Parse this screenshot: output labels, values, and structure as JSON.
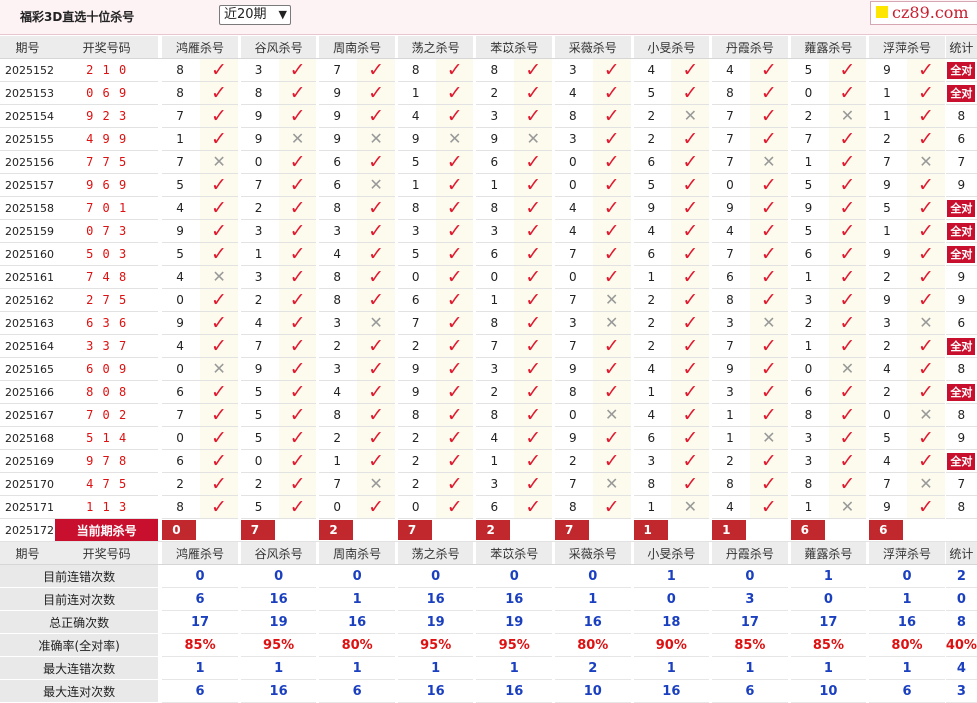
{
  "header": {
    "title": "福彩3D直选十位杀号",
    "period_selected": "近20期",
    "logo_text": "cz89.com"
  },
  "columns": {
    "period": "期号",
    "draw": "开奖号码",
    "stats": "统计",
    "all_correct": "全对",
    "current_label": "当前期杀号"
  },
  "experts": [
    "鸿雁杀号",
    "谷风杀号",
    "周南杀号",
    "荡之杀号",
    "苯苡杀号",
    "采薇杀号",
    "小旻杀号",
    "丹霞杀号",
    "蕹露杀号",
    "浮萍杀号"
  ],
  "rows": [
    {
      "period": "2025152",
      "draw": "2 1 0",
      "kills": [
        "8",
        "3",
        "7",
        "8",
        "8",
        "3",
        "4",
        "4",
        "5",
        "9"
      ],
      "marks": [
        "ok",
        "ok",
        "ok",
        "ok",
        "ok",
        "ok",
        "ok",
        "ok",
        "ok",
        "ok"
      ],
      "stat": "全对"
    },
    {
      "period": "2025153",
      "draw": "0 6 9",
      "kills": [
        "8",
        "8",
        "9",
        "1",
        "2",
        "4",
        "5",
        "8",
        "0",
        "1"
      ],
      "marks": [
        "ok",
        "ok",
        "ok",
        "ok",
        "ok",
        "ok",
        "ok",
        "ok",
        "ok",
        "ok"
      ],
      "stat": "全对"
    },
    {
      "period": "2025154",
      "draw": "9 2 3",
      "kills": [
        "7",
        "9",
        "9",
        "4",
        "3",
        "8",
        "2",
        "7",
        "2",
        "1"
      ],
      "marks": [
        "ok",
        "ok",
        "ok",
        "ok",
        "ok",
        "ok",
        "no",
        "ok",
        "no",
        "ok"
      ],
      "stat": "8"
    },
    {
      "period": "2025155",
      "draw": "4 9 9",
      "kills": [
        "1",
        "9",
        "9",
        "9",
        "9",
        "3",
        "2",
        "7",
        "7",
        "2"
      ],
      "marks": [
        "ok",
        "no",
        "no",
        "no",
        "no",
        "ok",
        "ok",
        "ok",
        "ok",
        "ok"
      ],
      "stat": "6"
    },
    {
      "period": "2025156",
      "draw": "7 7 5",
      "kills": [
        "7",
        "0",
        "6",
        "5",
        "6",
        "0",
        "6",
        "7",
        "1",
        "7"
      ],
      "marks": [
        "no",
        "ok",
        "ok",
        "ok",
        "ok",
        "ok",
        "ok",
        "no",
        "ok",
        "no"
      ],
      "stat": "7"
    },
    {
      "period": "2025157",
      "draw": "9 6 9",
      "kills": [
        "5",
        "7",
        "6",
        "1",
        "1",
        "0",
        "5",
        "0",
        "5",
        "9"
      ],
      "marks": [
        "ok",
        "ok",
        "no",
        "ok",
        "ok",
        "ok",
        "ok",
        "ok",
        "ok",
        "ok"
      ],
      "stat": "9"
    },
    {
      "period": "2025158",
      "draw": "7 0 1",
      "kills": [
        "4",
        "2",
        "8",
        "8",
        "8",
        "4",
        "9",
        "9",
        "9",
        "5"
      ],
      "marks": [
        "ok",
        "ok",
        "ok",
        "ok",
        "ok",
        "ok",
        "ok",
        "ok",
        "ok",
        "ok"
      ],
      "stat": "全对"
    },
    {
      "period": "2025159",
      "draw": "0 7 3",
      "kills": [
        "9",
        "3",
        "3",
        "3",
        "3",
        "4",
        "4",
        "4",
        "5",
        "1"
      ],
      "marks": [
        "ok",
        "ok",
        "ok",
        "ok",
        "ok",
        "ok",
        "ok",
        "ok",
        "ok",
        "ok"
      ],
      "stat": "全对"
    },
    {
      "period": "2025160",
      "draw": "5 0 3",
      "kills": [
        "5",
        "1",
        "4",
        "5",
        "6",
        "7",
        "6",
        "7",
        "6",
        "9"
      ],
      "marks": [
        "ok",
        "ok",
        "ok",
        "ok",
        "ok",
        "ok",
        "ok",
        "ok",
        "ok",
        "ok"
      ],
      "stat": "全对"
    },
    {
      "period": "2025161",
      "draw": "7 4 8",
      "kills": [
        "4",
        "3",
        "8",
        "0",
        "0",
        "0",
        "1",
        "6",
        "1",
        "2"
      ],
      "marks": [
        "no",
        "ok",
        "ok",
        "ok",
        "ok",
        "ok",
        "ok",
        "ok",
        "ok",
        "ok"
      ],
      "stat": "9"
    },
    {
      "period": "2025162",
      "draw": "2 7 5",
      "kills": [
        "0",
        "2",
        "8",
        "6",
        "1",
        "7",
        "2",
        "8",
        "3",
        "9"
      ],
      "marks": [
        "ok",
        "ok",
        "ok",
        "ok",
        "ok",
        "no",
        "ok",
        "ok",
        "ok",
        "ok"
      ],
      "stat": "9"
    },
    {
      "period": "2025163",
      "draw": "6 3 6",
      "kills": [
        "9",
        "4",
        "3",
        "7",
        "8",
        "3",
        "2",
        "3",
        "2",
        "3"
      ],
      "marks": [
        "ok",
        "ok",
        "no",
        "ok",
        "ok",
        "no",
        "ok",
        "no",
        "ok",
        "no"
      ],
      "stat": "6"
    },
    {
      "period": "2025164",
      "draw": "3 3 7",
      "kills": [
        "4",
        "7",
        "2",
        "2",
        "7",
        "7",
        "2",
        "7",
        "1",
        "2"
      ],
      "marks": [
        "ok",
        "ok",
        "ok",
        "ok",
        "ok",
        "ok",
        "ok",
        "ok",
        "ok",
        "ok"
      ],
      "stat": "全对"
    },
    {
      "period": "2025165",
      "draw": "6 0 9",
      "kills": [
        "0",
        "9",
        "3",
        "9",
        "3",
        "9",
        "4",
        "9",
        "0",
        "4"
      ],
      "marks": [
        "no",
        "ok",
        "ok",
        "ok",
        "ok",
        "ok",
        "ok",
        "ok",
        "no",
        "ok"
      ],
      "stat": "8"
    },
    {
      "period": "2025166",
      "draw": "8 0 8",
      "kills": [
        "6",
        "5",
        "4",
        "9",
        "2",
        "8",
        "1",
        "3",
        "6",
        "2"
      ],
      "marks": [
        "ok",
        "ok",
        "ok",
        "ok",
        "ok",
        "ok",
        "ok",
        "ok",
        "ok",
        "ok"
      ],
      "stat": "全对"
    },
    {
      "period": "2025167",
      "draw": "7 0 2",
      "kills": [
        "7",
        "5",
        "8",
        "8",
        "8",
        "0",
        "4",
        "1",
        "8",
        "0"
      ],
      "marks": [
        "ok",
        "ok",
        "ok",
        "ok",
        "ok",
        "no",
        "ok",
        "ok",
        "ok",
        "no"
      ],
      "stat": "8"
    },
    {
      "period": "2025168",
      "draw": "5 1 4",
      "kills": [
        "0",
        "5",
        "2",
        "2",
        "4",
        "9",
        "6",
        "1",
        "3",
        "5"
      ],
      "marks": [
        "ok",
        "ok",
        "ok",
        "ok",
        "ok",
        "ok",
        "ok",
        "no",
        "ok",
        "ok"
      ],
      "stat": "9"
    },
    {
      "period": "2025169",
      "draw": "9 7 8",
      "kills": [
        "6",
        "0",
        "1",
        "2",
        "1",
        "2",
        "3",
        "2",
        "3",
        "4"
      ],
      "marks": [
        "ok",
        "ok",
        "ok",
        "ok",
        "ok",
        "ok",
        "ok",
        "ok",
        "ok",
        "ok"
      ],
      "stat": "全对"
    },
    {
      "period": "2025170",
      "draw": "4 7 5",
      "kills": [
        "2",
        "2",
        "7",
        "2",
        "3",
        "7",
        "8",
        "8",
        "8",
        "7"
      ],
      "marks": [
        "ok",
        "ok",
        "no",
        "ok",
        "ok",
        "no",
        "ok",
        "ok",
        "ok",
        "no"
      ],
      "stat": "7"
    },
    {
      "period": "2025171",
      "draw": "1 1 3",
      "kills": [
        "8",
        "5",
        "0",
        "0",
        "6",
        "8",
        "1",
        "4",
        "1",
        "9"
      ],
      "marks": [
        "ok",
        "ok",
        "ok",
        "ok",
        "ok",
        "ok",
        "no",
        "ok",
        "no",
        "ok"
      ],
      "stat": "8"
    }
  ],
  "current": {
    "period": "2025172",
    "predictions": [
      "0",
      "7",
      "2",
      "7",
      "2",
      "7",
      "1",
      "1",
      "6",
      "6"
    ]
  },
  "summary": [
    {
      "label": "目前连错次数",
      "values": [
        "0",
        "0",
        "0",
        "0",
        "0",
        "0",
        "1",
        "0",
        "1",
        "0"
      ],
      "stat": "2"
    },
    {
      "label": "目前连对次数",
      "values": [
        "6",
        "16",
        "1",
        "16",
        "16",
        "1",
        "0",
        "3",
        "0",
        "1"
      ],
      "stat": "0"
    },
    {
      "label": "总正确次数",
      "values": [
        "17",
        "19",
        "16",
        "19",
        "19",
        "16",
        "18",
        "17",
        "17",
        "16"
      ],
      "stat": "8"
    },
    {
      "label": "准确率(全对率)",
      "values": [
        "85%",
        "95%",
        "80%",
        "95%",
        "95%",
        "80%",
        "90%",
        "85%",
        "85%",
        "80%"
      ],
      "stat": "40%"
    },
    {
      "label": "最大连错次数",
      "values": [
        "1",
        "1",
        "1",
        "1",
        "1",
        "2",
        "1",
        "1",
        "1",
        "1"
      ],
      "stat": "4"
    },
    {
      "label": "最大连对次数",
      "values": [
        "6",
        "16",
        "6",
        "16",
        "16",
        "10",
        "16",
        "6",
        "10",
        "6"
      ],
      "stat": "3"
    }
  ]
}
